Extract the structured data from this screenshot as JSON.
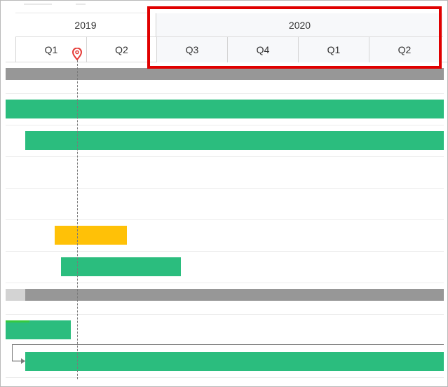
{
  "timeline": {
    "years": [
      {
        "label": "2019"
      },
      {
        "label": "2020"
      }
    ],
    "quarters": [
      {
        "label": "Q1"
      },
      {
        "label": "Q2"
      },
      {
        "label": "Q3"
      },
      {
        "label": "Q4"
      },
      {
        "label": "Q1"
      },
      {
        "label": "Q2"
      }
    ]
  },
  "colors": {
    "task_green": "#2bbd7e",
    "task_yellow": "#ffc107",
    "summary_gray": "#979797",
    "highlight_red": "#e00000",
    "today_marker": "#e53935"
  },
  "icons": {
    "today": "map-pin-icon",
    "dependency": "arrow-right-icon"
  }
}
